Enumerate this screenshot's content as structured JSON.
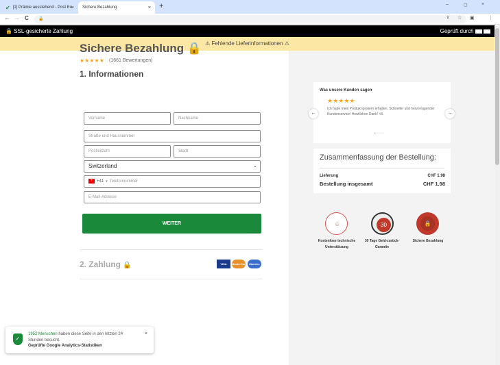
{
  "browser": {
    "tab1_label": "[1] Prämie ausstehend - Post Eu",
    "tab2_label": "Sichere Bezahlung",
    "tab_close": "×",
    "new_tab": "+",
    "win_min": "–",
    "win_max": "◻",
    "win_close": "×",
    "back": "←",
    "forward": "→",
    "reload": "C",
    "lock": "🔒",
    "share_icon": "⇪",
    "star_icon": "☆",
    "panel_icon": "▣",
    "menu_icon": "⋮"
  },
  "topbar": {
    "left": "🔒 SSL-gesicherte Zahlung",
    "right": "Geprüft durch"
  },
  "warning": {
    "text": "⚠ Fehlende Lieferinformationen ⚠"
  },
  "form": {
    "title": "Sichere Bezahlung 🔒",
    "stars": "★★★★★",
    "reviews": "(1661 Bewertungen)",
    "section1": "1. Informationen",
    "firstname_placeholder": "Vorname",
    "lastname_placeholder": "Nachname",
    "street_placeholder": "Straße und Hausnummer",
    "zip_placeholder": "Postleitzahl",
    "city_placeholder": "Stadt",
    "country_value": "Switzerland",
    "country_arrow": "⌄",
    "phone_code": "+41",
    "phone_code_arrow": "▾",
    "phone_placeholder": "Telefonnummer",
    "email_placeholder": "E-Mail-Adresse",
    "submit": "WEITER",
    "section2": "2. Zahlung",
    "section2_lock": "🔒",
    "cards": [
      "VISA",
      "MasterCard",
      "Maestro"
    ]
  },
  "testimonial": {
    "title": "Was unsere Kunden sagen",
    "stars": "★★★★★",
    "text": "Ich habe mein Produkt gestern erhalten. Schneller und hervorragender Kundenservice! Herzlichen Dank! <3.",
    "dots": "●○○○○",
    "prev": "←",
    "next": "→"
  },
  "summary": {
    "title": "Zusammenfassung der Bestellung:",
    "shipping_label": "Lieferung",
    "shipping_value": "CHF 1.98",
    "total_label": "Bestellung insgesamt",
    "total_value": "CHF 1.98"
  },
  "badges": [
    {
      "label": "Kostenlose technische Unterstützung",
      "icon": "headset-icon"
    },
    {
      "label": "30 Tage Geld-zurück-Garantie",
      "icon": "guarantee-icon"
    },
    {
      "label": "Sichere Bezahlung",
      "icon": "secure-icon"
    }
  ],
  "toast": {
    "count": "1952 Menschen",
    "rest": " haben diese Seite in den letzten 24 Stunden besucht.",
    "bold": "Geprüfte Google Analytics-Statistiken",
    "close": "×",
    "shield": "✓"
  },
  "colors": {
    "green": "#1a8a3a",
    "warn": "#fde7a5",
    "star": "#f5a623"
  }
}
